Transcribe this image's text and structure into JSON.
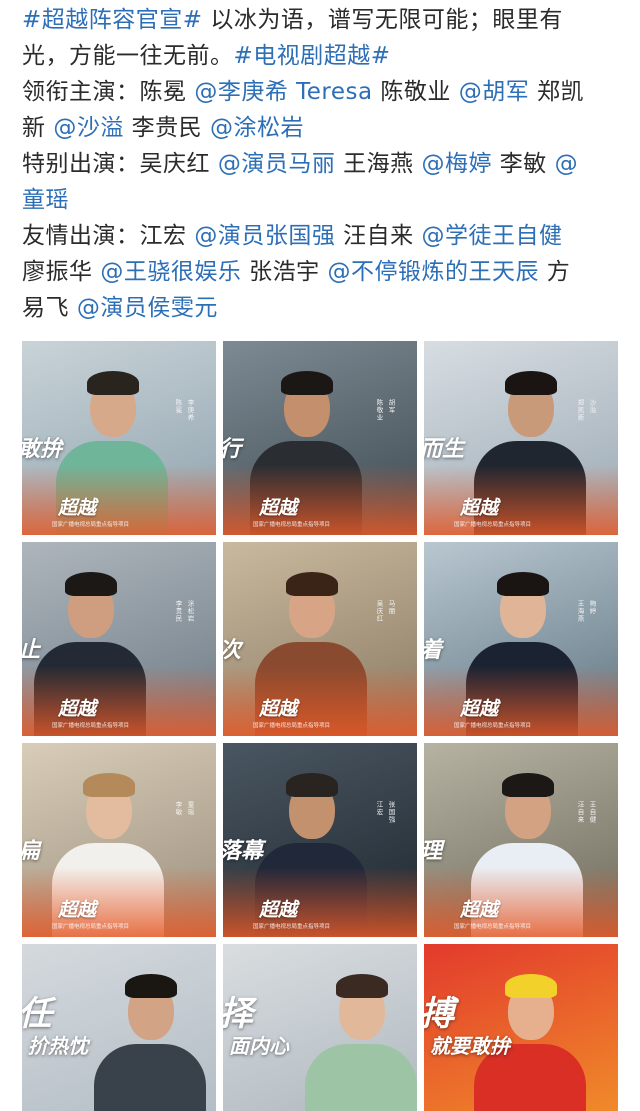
{
  "post": {
    "lines": [
      [
        {
          "t": "hashtag",
          "v": "#超越阵容官宣#"
        },
        {
          "t": "plain",
          "v": " 以冰为语，谱写无限可能；眼里有"
        }
      ],
      [
        {
          "t": "plain",
          "v": "光，方能一往无前。"
        },
        {
          "t": "hashtag",
          "v": "#电视剧超越#"
        }
      ],
      [
        {
          "t": "plain",
          "v": "领衔主演：陈冕 "
        },
        {
          "t": "mention",
          "v": "@李庚希 Teresa"
        },
        {
          "t": "plain",
          "v": " 陈敬业 "
        },
        {
          "t": "mention",
          "v": "@胡军"
        },
        {
          "t": "plain",
          "v": " 郑凯"
        }
      ],
      [
        {
          "t": "plain",
          "v": "新 "
        },
        {
          "t": "mention",
          "v": "@沙溢"
        },
        {
          "t": "plain",
          "v": " 李贵民 "
        },
        {
          "t": "mention",
          "v": "@涂松岩"
        }
      ],
      [
        {
          "t": "plain",
          "v": "特别出演：吴庆红 "
        },
        {
          "t": "mention",
          "v": "@演员马丽"
        },
        {
          "t": "plain",
          "v": " 王海燕 "
        },
        {
          "t": "mention",
          "v": "@梅婷"
        },
        {
          "t": "plain",
          "v": " 李敏 "
        },
        {
          "t": "mention",
          "v": "@"
        }
      ],
      [
        {
          "t": "mention",
          "v": "童瑶"
        }
      ],
      [
        {
          "t": "plain",
          "v": "友情出演：江宏 "
        },
        {
          "t": "mention",
          "v": "@演员张国强"
        },
        {
          "t": "plain",
          "v": " 汪自来 "
        },
        {
          "t": "mention",
          "v": "@学徒王自健"
        }
      ],
      [
        {
          "t": "plain",
          "v": "廖振华 "
        },
        {
          "t": "mention",
          "v": "@王骁很娱乐"
        },
        {
          "t": "plain",
          "v": " 张浩宇 "
        },
        {
          "t": "mention",
          "v": "@不停锻炼的王天辰"
        },
        {
          "t": "plain",
          "v": " 方"
        }
      ],
      [
        {
          "t": "plain",
          "v": "易飞 "
        },
        {
          "t": "mention",
          "v": "@演员侯雯元"
        }
      ]
    ]
  },
  "posters": [
    {
      "id": "p1",
      "logo": "超越",
      "names": [
        "李庚希",
        "陈冕"
      ],
      "slogan": "敢拚",
      "tagline": "国家广播电视总局重点指导项目",
      "colors": {
        "bg1": "#c9d3d8",
        "bg2": "#8ea2ad",
        "body": "#6fb59a",
        "hair": "#2a241f",
        "skin": "#d6a98a"
      }
    },
    {
      "id": "p2",
      "logo": "超越",
      "names": [
        "胡军",
        "陈敬业"
      ],
      "slogan": "行",
      "tagline": "国家广播电视总局重点指导项目",
      "colors": {
        "bg1": "#7d8a93",
        "bg2": "#3f4b52",
        "body": "#2a2e33",
        "hair": "#1b1714",
        "skin": "#c48f6c"
      }
    },
    {
      "id": "p3",
      "logo": "超越",
      "names": [
        "沙溢",
        "郑凯新"
      ],
      "slogan": "而生",
      "tagline": "国家广播电视总局重点指导项目",
      "colors": {
        "bg1": "#d7dde2",
        "bg2": "#9aa8b3",
        "body": "#1f2630",
        "hair": "#1a1512",
        "skin": "#c99a79"
      }
    },
    {
      "id": "p4",
      "logo": "超越",
      "names": [
        "涂松岩",
        "李贵民"
      ],
      "slogan": "止",
      "tagline": "国家广播电视总局重点指导项目",
      "colors": {
        "bg1": "#aeb6bc",
        "bg2": "#6e7b86",
        "body": "#232a35",
        "hair": "#1c1815",
        "skin": "#cf9e80"
      }
    },
    {
      "id": "p5",
      "logo": "超越",
      "names": [
        "马丽",
        "吴庆红"
      ],
      "slogan": "次",
      "tagline": "国家广播电视总局重点指导项目",
      "colors": {
        "bg1": "#c9b99e",
        "bg2": "#8a7a64",
        "body": "#8a4a2f",
        "hair": "#3a2418",
        "skin": "#d7a586"
      }
    },
    {
      "id": "p6",
      "logo": "超越",
      "names": [
        "梅婷",
        "王海燕"
      ],
      "slogan": "着",
      "tagline": "国家广播电视总局重点指导项目",
      "colors": {
        "bg1": "#b9c7d0",
        "bg2": "#5f7582",
        "body": "#1b2333",
        "hair": "#1a1512",
        "skin": "#e0b597"
      }
    },
    {
      "id": "p7",
      "logo": "超越",
      "names": [
        "童瑶",
        "李敏"
      ],
      "slogan": "扁",
      "tagline": "国家广播电视总局重点指导项目",
      "colors": {
        "bg1": "#d8cdb9",
        "bg2": "#9b8f7d",
        "body": "#f2f0ec",
        "hair": "#b48a5a",
        "skin": "#e3bca0"
      }
    },
    {
      "id": "p8",
      "logo": "超越",
      "names": [
        "张国强",
        "江宏"
      ],
      "slogan": "落幕",
      "tagline": "国家广播电视总局重点指导项目",
      "colors": {
        "bg1": "#4a5661",
        "bg2": "#1f2830",
        "body": "#20283a",
        "hair": "#2a2420",
        "skin": "#c4916f"
      }
    },
    {
      "id": "p9",
      "logo": "超越",
      "names": [
        "王自健",
        "汪自来"
      ],
      "slogan": "理",
      "tagline": "国家广播电视总局重点指导项目",
      "colors": {
        "bg1": "#b7b3a3",
        "bg2": "#6d6a5c",
        "body": "#e9eef4",
        "hair": "#1c1815",
        "skin": "#d2a283"
      }
    },
    {
      "id": "p10",
      "logo": "超越",
      "names": [],
      "slogan": "任",
      "slogan2": "扴热忱",
      "tagline": "",
      "colors": {
        "bg1": "#d4d9dd",
        "bg2": "#b4bec6",
        "body": "#39424a",
        "hair": "#1a1612",
        "skin": "#d2a384"
      }
    },
    {
      "id": "p11",
      "logo": "超越",
      "names": [],
      "slogan": "择",
      "slogan2": "面内心",
      "tagline": "",
      "colors": {
        "bg1": "#d9dde0",
        "bg2": "#b0b9c0",
        "body": "#9ec4a6",
        "hair": "#3a2a22",
        "skin": "#e1b89a"
      }
    },
    {
      "id": "p12",
      "logo": "超越",
      "names": [],
      "slogan": "搏",
      "slogan2": "就要敢拚",
      "tagline": "",
      "colors": {
        "bg1": "#e23a2c",
        "bg2": "#f08a2a",
        "body": "#d92f25",
        "hair": "#f2d22a",
        "skin": "#e6b08e"
      }
    }
  ]
}
